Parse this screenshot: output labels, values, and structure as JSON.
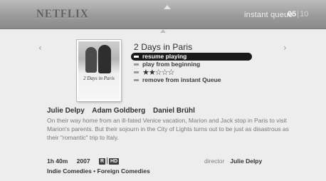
{
  "header": {
    "logo": "NETFLIX",
    "queue_label": "instant queue",
    "page_current": "05",
    "page_separator": "|",
    "page_total": "10"
  },
  "movie": {
    "title": "2 Days in Paris",
    "poster_title": "2 Days in Paris",
    "menu": [
      {
        "label": "resume playing",
        "selected": true
      },
      {
        "label": "play from beginning",
        "selected": false
      },
      {
        "label": "★★☆☆☆",
        "selected": false,
        "type": "rating"
      },
      {
        "label": "remove from instant Queue",
        "selected": false
      }
    ],
    "rating_stars": 2.5,
    "cast": [
      "Julie Delpy",
      "Adam Goldberg",
      "Daniel Brühl"
    ],
    "synopsis": "On their way home from an ill-fated Venice vacation, Marion and Jack stop in Paris to visit Marion's parents. But their sojourn in the City of Lights turns out to be just as disastrous as their \"romantic\" trip to Italy.",
    "runtime": "1h 40m",
    "year": "2007",
    "mpaa_rating": "R",
    "hd_badge": "HD",
    "director_label": "director",
    "director": "Julie Delpy",
    "genres": "Indie Comedies • Foreign Comedies"
  },
  "icons": {
    "up_arrow": "up-arrow-icon",
    "left_arrow": "left-arrow-icon",
    "right_arrow": "right-arrow-icon"
  }
}
